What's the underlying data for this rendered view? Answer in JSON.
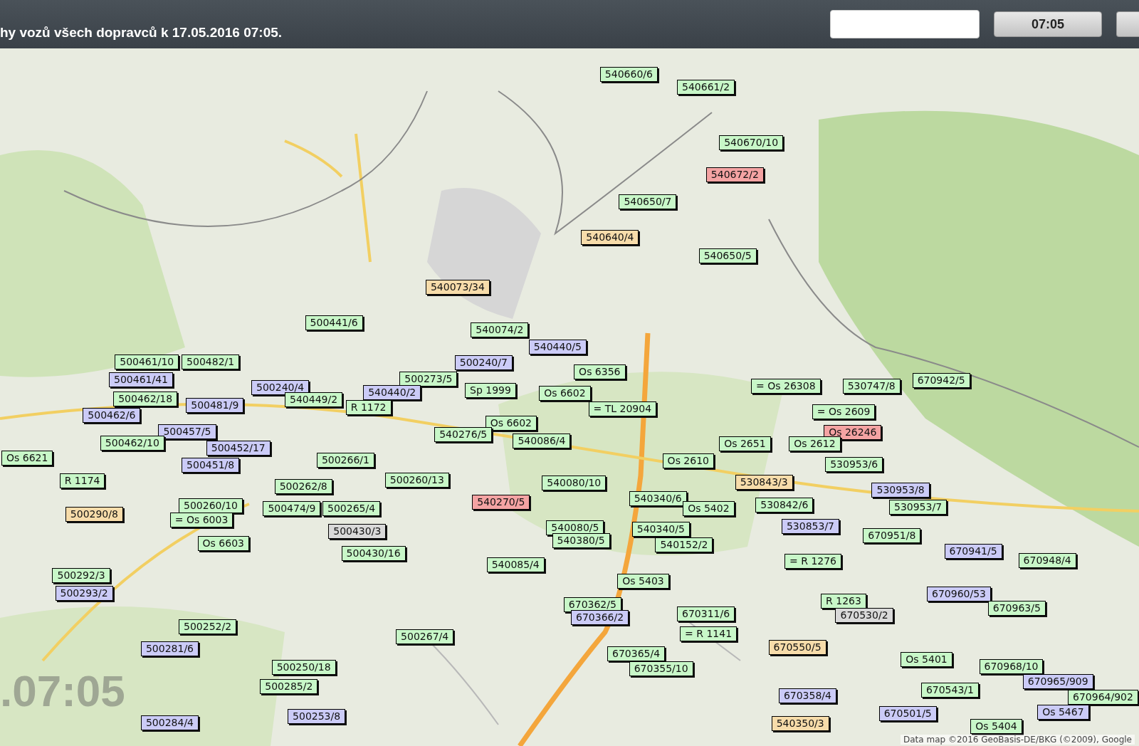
{
  "header": {
    "title": "hy vozů všech dopravců k 17.05.2016 07:05.",
    "time_button": "07:05"
  },
  "map": {
    "clock_overlay": ".07:05",
    "attribution": "Data map ©2016 GeoBasis-DE/BKG (©2009), Google",
    "vehicles": [
      {
        "label": "540660/6",
        "color": "#c8f7c8"
      },
      {
        "label": "540661/2",
        "color": "#c8f7c8"
      },
      {
        "label": "540670/10",
        "color": "#c8f7c8"
      },
      {
        "label": "540672/2",
        "color": "#f4a3a3"
      },
      {
        "label": "540650/7",
        "color": "#c8f7c8"
      },
      {
        "label": "540640/4",
        "color": "#f7dcaa"
      },
      {
        "label": "540650/5",
        "color": "#c8f7c8"
      },
      {
        "label": "540073/34",
        "color": "#f7dcaa"
      },
      {
        "label": "500441/6",
        "color": "#c8f7c8"
      },
      {
        "label": "540074/2",
        "color": "#c8f7c8"
      },
      {
        "label": "540440/5",
        "color": "#cbcbf7"
      },
      {
        "label": "500461/10",
        "color": "#c8f7c8"
      },
      {
        "label": "500482/1",
        "color": "#c8f7c8"
      },
      {
        "label": "500461/41",
        "color": "#cbcbf7"
      },
      {
        "label": "500240/7",
        "color": "#cbcbf7"
      },
      {
        "label": "500273/5",
        "color": "#c8f7c8"
      },
      {
        "label": "Os 6356",
        "color": "#c8f7c8"
      },
      {
        "label": "500240/4",
        "color": "#cbcbf7"
      },
      {
        "label": "540440/2",
        "color": "#cbcbf7"
      },
      {
        "label": "540449/2",
        "color": "#c8f7c8"
      },
      {
        "label": "R 1172",
        "color": "#c8f7c8"
      },
      {
        "label": "Sp 1999",
        "color": "#c8f7c8"
      },
      {
        "label": "500462/18",
        "color": "#c8f7c8"
      },
      {
        "label": "500481/9",
        "color": "#cbcbf7"
      },
      {
        "label": "Os 6602",
        "color": "#c8f7c8"
      },
      {
        "label": "= TL 20904",
        "color": "#c8f7c8"
      },
      {
        "label": "500462/6",
        "color": "#cbcbf7"
      },
      {
        "label": "Os 6602",
        "color": "#c8f7c8"
      },
      {
        "label": "540276/5",
        "color": "#c8f7c8"
      },
      {
        "label": "540086/4",
        "color": "#c8f7c8"
      },
      {
        "label": "500457/5",
        "color": "#cbcbf7"
      },
      {
        "label": "500462/10",
        "color": "#c8f7c8"
      },
      {
        "label": "500452/17",
        "color": "#cbcbf7"
      },
      {
        "label": "Os 6621",
        "color": "#c8f7c8"
      },
      {
        "label": "500451/8",
        "color": "#cbcbf7"
      },
      {
        "label": "500266/1",
        "color": "#c8f7c8"
      },
      {
        "label": "R 1174",
        "color": "#c8f7c8"
      },
      {
        "label": "500262/8",
        "color": "#c8f7c8"
      },
      {
        "label": "500260/13",
        "color": "#c8f7c8"
      },
      {
        "label": "540270/5",
        "color": "#f4a3a3"
      },
      {
        "label": "540080/10",
        "color": "#c8f7c8"
      },
      {
        "label": "500260/10",
        "color": "#c8f7c8"
      },
      {
        "label": "500474/9",
        "color": "#c8f7c8"
      },
      {
        "label": "500265/4",
        "color": "#c8f7c8"
      },
      {
        "label": "500290/8",
        "color": "#f7dcaa"
      },
      {
        "label": "= Os 6003",
        "color": "#c8f7c8"
      },
      {
        "label": "500430/3",
        "color": "#d9d9d9"
      },
      {
        "label": "Os 6603",
        "color": "#c8f7c8"
      },
      {
        "label": "500430/16",
        "color": "#c8f7c8"
      },
      {
        "label": "540080/5",
        "color": "#c8f7c8"
      },
      {
        "label": "540380/5",
        "color": "#c8f7c8"
      },
      {
        "label": "540085/4",
        "color": "#c8f7c8"
      },
      {
        "label": "500292/3",
        "color": "#c8f7c8"
      },
      {
        "label": "500293/2",
        "color": "#cbcbf7"
      },
      {
        "label": "500252/2",
        "color": "#c8f7c8"
      },
      {
        "label": "500281/6",
        "color": "#cbcbf7"
      },
      {
        "label": "500267/4",
        "color": "#c8f7c8"
      },
      {
        "label": "500250/18",
        "color": "#c8f7c8"
      },
      {
        "label": "500285/2",
        "color": "#c8f7c8"
      },
      {
        "label": "500253/8",
        "color": "#cbcbf7"
      },
      {
        "label": "500284/4",
        "color": "#cbcbf7"
      },
      {
        "label": "540340/6",
        "color": "#c8f7c8"
      },
      {
        "label": "Os 5402",
        "color": "#c8f7c8"
      },
      {
        "label": "540340/5",
        "color": "#c8f7c8"
      },
      {
        "label": "540152/2",
        "color": "#c8f7c8"
      },
      {
        "label": "Os 5403",
        "color": "#c8f7c8"
      },
      {
        "label": "670362/5",
        "color": "#c8f7c8"
      },
      {
        "label": "670366/2",
        "color": "#cbcbf7"
      },
      {
        "label": "670311/6",
        "color": "#c8f7c8"
      },
      {
        "label": "= R 1141",
        "color": "#c8f7c8"
      },
      {
        "label": "670365/4",
        "color": "#c8f7c8"
      },
      {
        "label": "670355/10",
        "color": "#c8f7c8"
      },
      {
        "label": "Os 2610",
        "color": "#c8f7c8"
      },
      {
        "label": "= Os 26308",
        "color": "#c8f7c8"
      },
      {
        "label": "530747/8",
        "color": "#c8f7c8"
      },
      {
        "label": "670942/5",
        "color": "#c8f7c8"
      },
      {
        "label": "= Os 2609",
        "color": "#c8f7c8"
      },
      {
        "label": "Os 26246",
        "color": "#f4a3a3"
      },
      {
        "label": "Os 2651",
        "color": "#c8f7c8"
      },
      {
        "label": "Os 2612",
        "color": "#c8f7c8"
      },
      {
        "label": "530953/6",
        "color": "#c8f7c8"
      },
      {
        "label": "530843/3",
        "color": "#f7dcaa"
      },
      {
        "label": "530953/8",
        "color": "#cbcbf7"
      },
      {
        "label": "530842/6",
        "color": "#c8f7c8"
      },
      {
        "label": "530953/7",
        "color": "#c8f7c8"
      },
      {
        "label": "530853/7",
        "color": "#cbcbf7"
      },
      {
        "label": "670951/8",
        "color": "#c8f7c8"
      },
      {
        "label": "670941/5",
        "color": "#cbcbf7"
      },
      {
        "label": "= R 1276",
        "color": "#c8f7c8"
      },
      {
        "label": "670948/4",
        "color": "#c8f7c8"
      },
      {
        "label": "670960/53",
        "color": "#cbcbf7"
      },
      {
        "label": "R 1263",
        "color": "#c8f7c8"
      },
      {
        "label": "670963/5",
        "color": "#c8f7c8"
      },
      {
        "label": "670530/2",
        "color": "#d9d9d9"
      },
      {
        "label": "670550/5",
        "color": "#f7dcaa"
      },
      {
        "label": "Os 5401",
        "color": "#c8f7c8"
      },
      {
        "label": "670968/10",
        "color": "#c8f7c8"
      },
      {
        "label": "670965/909",
        "color": "#cbcbf7"
      },
      {
        "label": "670358/4",
        "color": "#cbcbf7"
      },
      {
        "label": "670543/1",
        "color": "#c8f7c8"
      },
      {
        "label": "670964/902",
        "color": "#c8f7c8"
      },
      {
        "label": "670501/5",
        "color": "#cbcbf7"
      },
      {
        "label": "Os 5467",
        "color": "#cbcbf7"
      },
      {
        "label": "540350/3",
        "color": "#f7dcaa"
      },
      {
        "label": "Os 5404",
        "color": "#c8f7c8"
      }
    ]
  }
}
